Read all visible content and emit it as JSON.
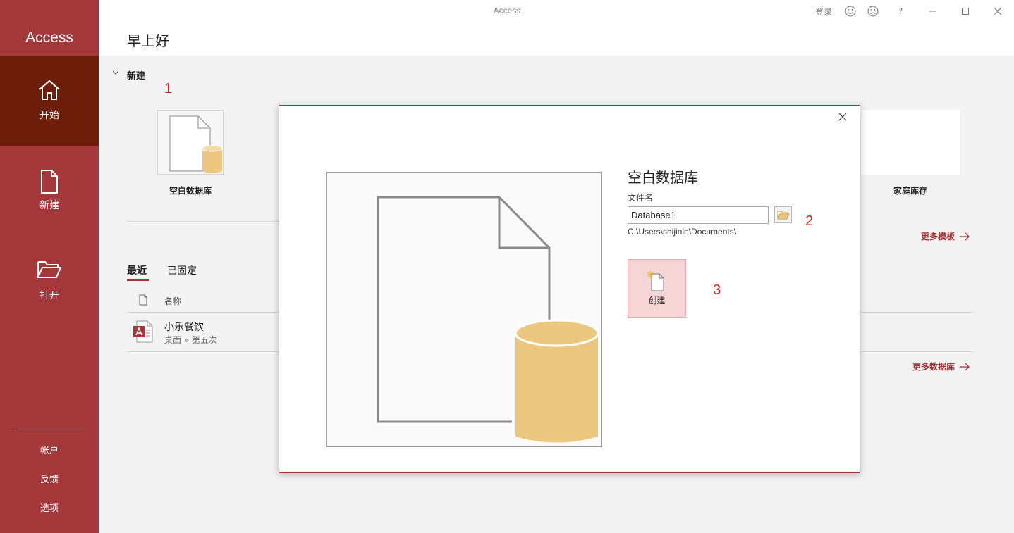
{
  "window": {
    "title": "Access",
    "sign_in": "登录",
    "help": "?"
  },
  "sidebar": {
    "app_name": "Access",
    "items": [
      {
        "label": "开始",
        "icon": "home-icon"
      },
      {
        "label": "新建",
        "icon": "new-file-icon"
      },
      {
        "label": "打开",
        "icon": "folder-open-icon"
      }
    ],
    "bottom": [
      "帐户",
      "反馈",
      "选项"
    ]
  },
  "header": {
    "greeting": "早上好"
  },
  "new_section": {
    "title": "新建",
    "templates": [
      {
        "label": "空白数据库"
      },
      {
        "label": "家庭库存"
      }
    ],
    "more_templates": "更多模板"
  },
  "recent": {
    "tabs": [
      "最近",
      "已固定"
    ],
    "column_name": "名称",
    "files": [
      {
        "name": "小乐餐饮",
        "path": "桌面 » 第五次"
      }
    ],
    "more_databases": "更多数据库"
  },
  "annotations": [
    "1",
    "2",
    "3"
  ],
  "dialog": {
    "title": "空白数据库",
    "filename_label": "文件名",
    "filename_value": "Database1",
    "path": "C:\\Users\\shijinle\\Documents\\",
    "create_label": "创建"
  },
  "colors": {
    "accent": "#a4373a",
    "sidebar_active": "#6e1f0b",
    "db_gold": "#ecc77f",
    "annotation": "#e02020"
  }
}
